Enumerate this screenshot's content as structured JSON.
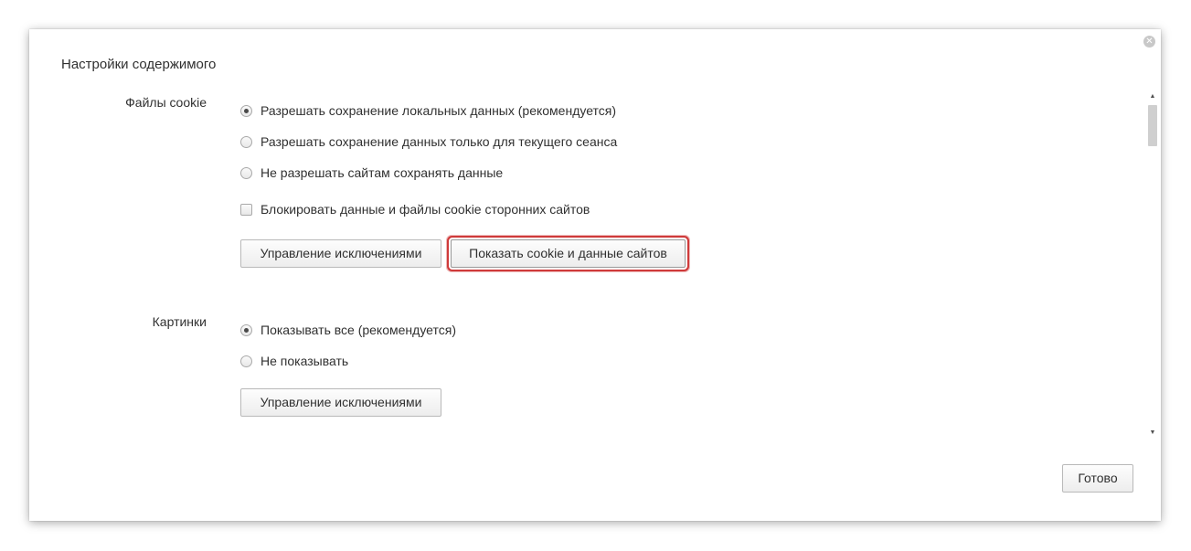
{
  "dialog": {
    "title": "Настройки содержимого",
    "close_icon": "close-icon",
    "done_label": "Готово"
  },
  "cookies": {
    "label": "Файлы cookie",
    "options": [
      {
        "label": "Разрешать сохранение локальных данных (рекомендуется)",
        "checked": true
      },
      {
        "label": "Разрешать сохранение данных только для текущего сеанса",
        "checked": false
      },
      {
        "label": "Не разрешать сайтам сохранять данные",
        "checked": false
      }
    ],
    "block_third_party": {
      "label": "Блокировать данные и файлы cookie сторонних сайтов",
      "checked": false
    },
    "manage_exceptions_label": "Управление исключениями",
    "show_cookies_label": "Показать cookie и данные сайтов"
  },
  "images": {
    "label": "Картинки",
    "options": [
      {
        "label": "Показывать все (рекомендуется)",
        "checked": true
      },
      {
        "label": "Не показывать",
        "checked": false
      }
    ],
    "manage_exceptions_label": "Управление исключениями"
  },
  "colors": {
    "highlight": "#cf3a3a"
  }
}
